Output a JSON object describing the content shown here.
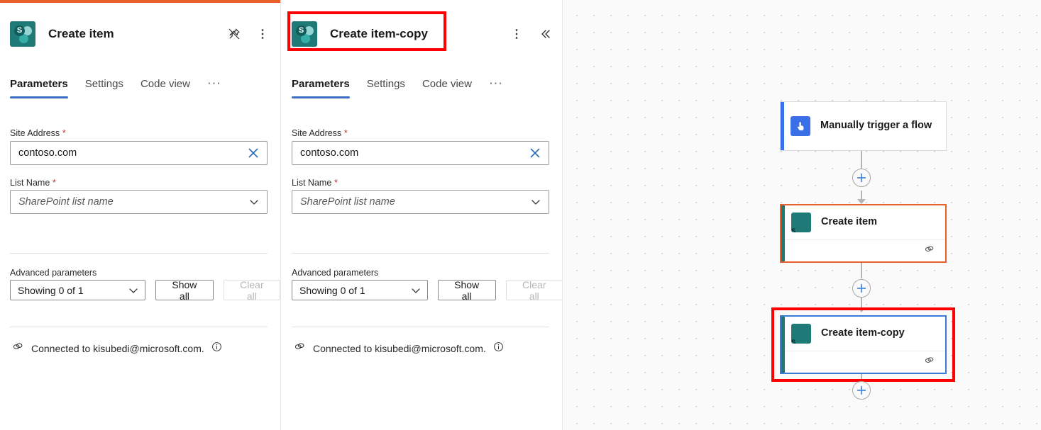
{
  "panels": [
    {
      "title": "Create item",
      "icon": "sharepoint-icon",
      "top_accent_color": "#E8612B",
      "actions": [
        {
          "name": "unpin-icon",
          "label": "Unpin"
        },
        {
          "name": "more-options-icon",
          "label": "More commands"
        }
      ],
      "tabs": [
        {
          "label": "Parameters",
          "active": true
        },
        {
          "label": "Settings",
          "active": false
        },
        {
          "label": "Code view",
          "active": false
        }
      ],
      "tab_overflow": "···",
      "fields": [
        {
          "label": "Site Address",
          "required": true,
          "value": "contoso.com",
          "placeholder": "",
          "control": "clear-x"
        },
        {
          "label": "List Name",
          "required": true,
          "value": "",
          "placeholder": "SharePoint list name",
          "control": "chevron-down"
        }
      ],
      "advanced": {
        "label": "Advanced parameters",
        "select_value": "Showing 0 of 1",
        "show_all_label": "Show all",
        "clear_all_label": "Clear all",
        "clear_all_disabled": true
      },
      "connection": {
        "text": "Connected to kisubedi@microsoft.com.",
        "link_icon": "link-icon",
        "info_icon": "info-icon"
      }
    },
    {
      "title": "Create item-copy",
      "icon": "sharepoint-icon",
      "top_accent_color": "#ffffff",
      "highlighted": true,
      "actions": [
        {
          "name": "more-options-icon",
          "label": "More commands"
        },
        {
          "name": "collapse-icon",
          "label": "Collapse pane"
        }
      ],
      "tabs": [
        {
          "label": "Parameters",
          "active": true
        },
        {
          "label": "Settings",
          "active": false
        },
        {
          "label": "Code view",
          "active": false
        }
      ],
      "tab_overflow": "···",
      "fields": [
        {
          "label": "Site Address",
          "required": true,
          "value": "contoso.com",
          "placeholder": "",
          "control": "clear-x"
        },
        {
          "label": "List Name",
          "required": true,
          "value": "",
          "placeholder": "SharePoint list name",
          "control": "chevron-down"
        }
      ],
      "advanced": {
        "label": "Advanced parameters",
        "select_value": "Showing 0 of 1",
        "show_all_label": "Show all",
        "clear_all_label": "Clear all",
        "clear_all_disabled": true
      },
      "connection": {
        "text": "Connected to kisubedi@microsoft.com.",
        "link_icon": "link-icon",
        "info_icon": "info-icon"
      }
    }
  ],
  "canvas": {
    "nodes": [
      {
        "label": "Manually trigger a flow",
        "icon": "manual-trigger-icon",
        "accent_color": "#3A6FE8",
        "selected_border": "#dcdcdc",
        "has_footer": false,
        "annotated": false
      },
      {
        "label": "Create item",
        "icon": "sharepoint-icon",
        "accent_color": "#1F7A77",
        "selected_border": "#E8612B",
        "has_footer": true,
        "footer_icon": "link-icon",
        "annotated": false
      },
      {
        "label": "Create item-copy",
        "icon": "sharepoint-icon",
        "accent_color": "#1F7A77",
        "selected_border": "#3A7BD5",
        "has_footer": true,
        "footer_icon": "link-icon",
        "annotated": true
      }
    ],
    "add_buttons": [
      {
        "name": "add-step-button-1"
      },
      {
        "name": "add-step-button-2"
      },
      {
        "name": "add-step-button-3"
      }
    ],
    "grid": "dotted"
  },
  "colors": {
    "accent_orange": "#E8612B",
    "annotation_red": "#FF0000",
    "tab_underline": "#3B6EC2",
    "sharepoint_teal": "#1F7A77",
    "trigger_blue": "#3A6FE8"
  }
}
